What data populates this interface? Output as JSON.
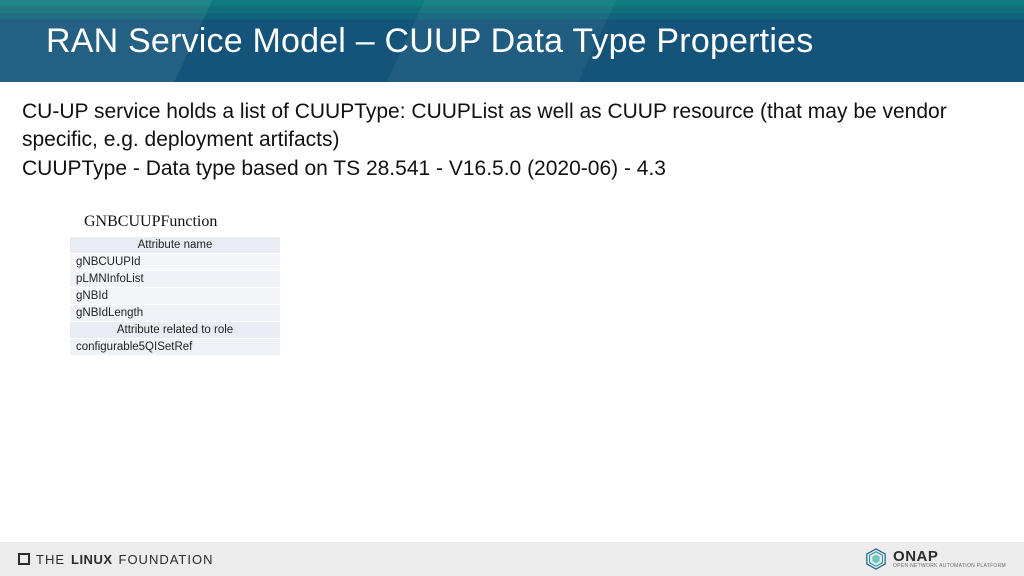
{
  "header": {
    "title": "RAN Service Model – CUUP Data Type Properties"
  },
  "body": {
    "p1": "CU-UP service holds a list of CUUPType: CUUPList as well as CUUP resource (that may be vendor specific, e.g. deployment artifacts)",
    "p2": "CUUPType - Data type based on TS 28.541 - V16.5.0 (2020-06) - 4.3"
  },
  "table": {
    "title": "GNBCUUPFunction",
    "header1": "Attribute name",
    "rows1": [
      "gNBCUUPId",
      "pLMNInfoList",
      "gNBId",
      "gNBIdLength"
    ],
    "header2": "Attribute related to role",
    "rows2": [
      "configurable5QISetRef"
    ]
  },
  "footer": {
    "lf_the": "THE",
    "lf_linux": "LINUX",
    "lf_foundation": "FOUNDATION",
    "onap": "ONAP",
    "onap_sub": "OPEN NETWORK AUTOMATION PLATFORM"
  }
}
